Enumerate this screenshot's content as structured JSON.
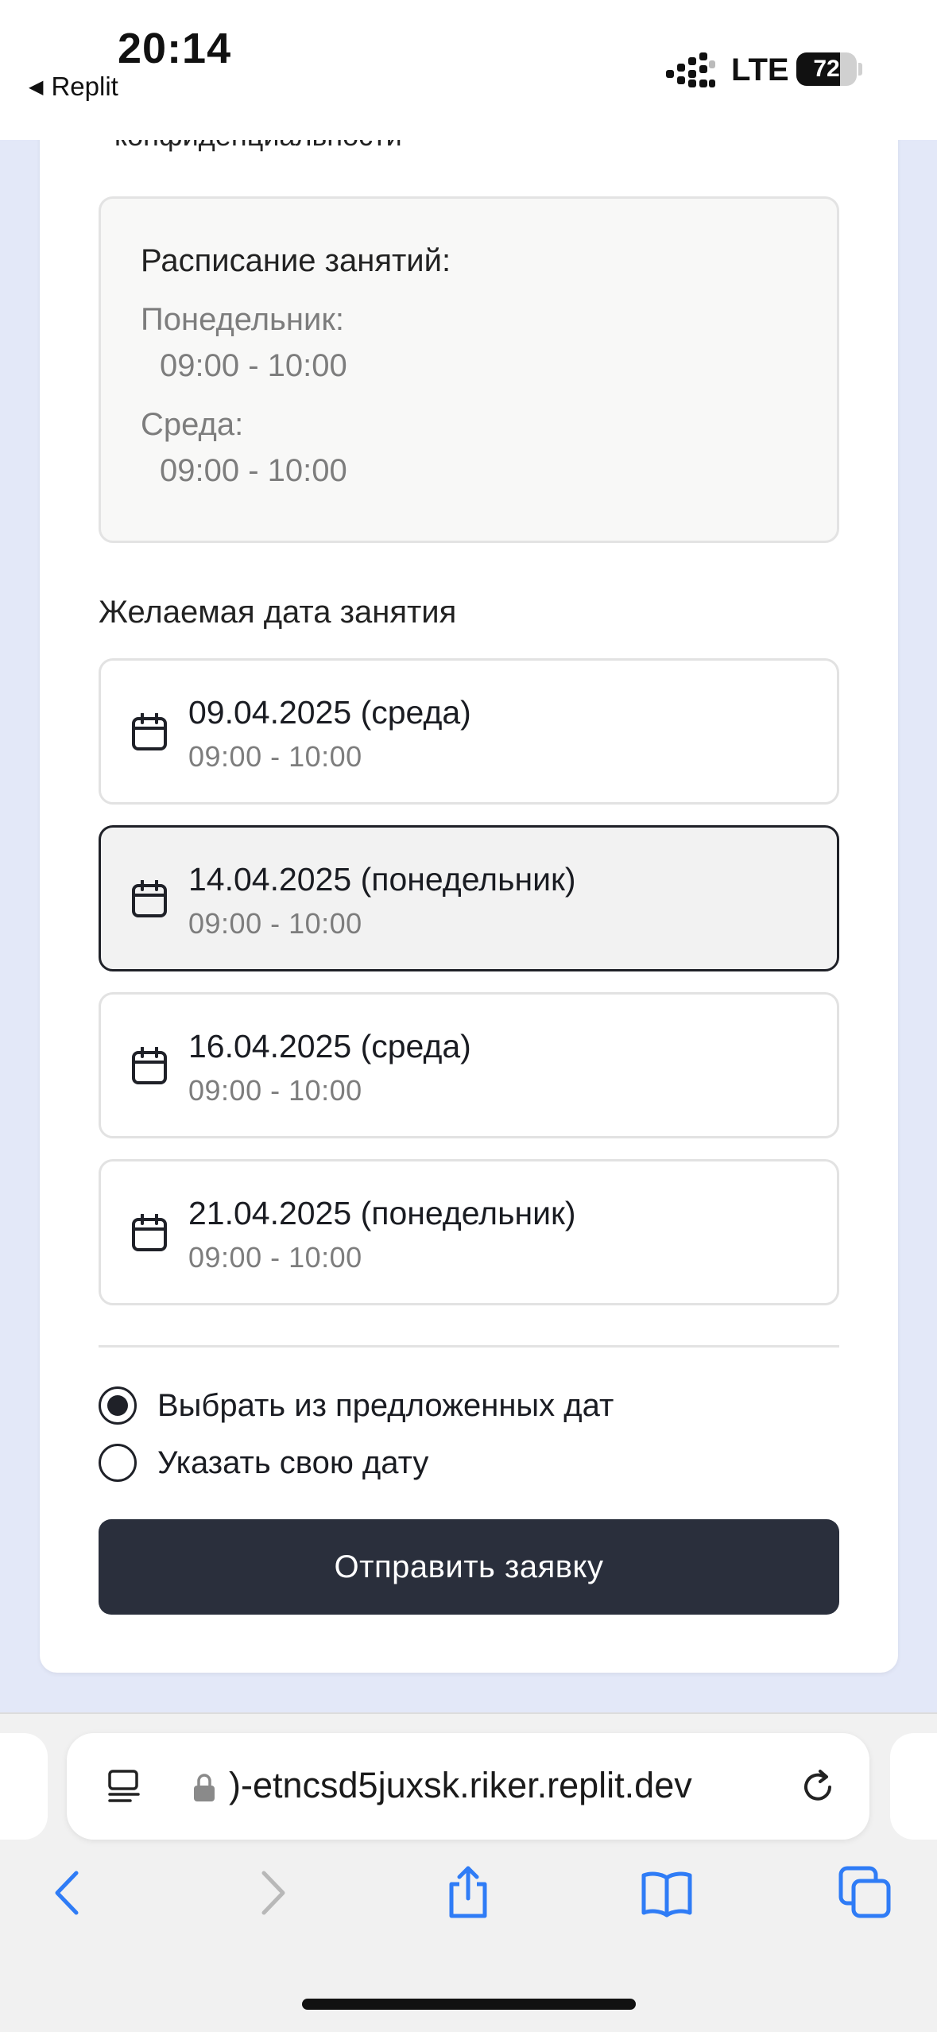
{
  "status_bar": {
    "time": "20:14",
    "back_app": "Replit",
    "network": "LTE",
    "battery_percent": 72
  },
  "page": {
    "clipped_text": "конфиденциальности",
    "schedule": {
      "title": "Расписание занятий:",
      "entries": [
        {
          "day": "Понедельник:",
          "time": "09:00 - 10:00"
        },
        {
          "day": "Среда:",
          "time": "09:00 - 10:00"
        }
      ]
    },
    "date_label": "Желаемая дата занятия",
    "date_options": [
      {
        "title": "09.04.2025 (среда)",
        "time": "09:00 - 10:00",
        "selected": false
      },
      {
        "title": "14.04.2025 (понедельник)",
        "time": "09:00 - 10:00",
        "selected": true
      },
      {
        "title": "16.04.2025 (среда)",
        "time": "09:00 - 10:00",
        "selected": false
      },
      {
        "title": "21.04.2025 (понедельник)",
        "time": "09:00 - 10:00",
        "selected": false
      }
    ],
    "radio_options": [
      {
        "label": "Выбрать из предложенных дат",
        "checked": true
      },
      {
        "label": "Указать свою дату",
        "checked": false
      }
    ],
    "submit_label": "Отправить заявку"
  },
  "browser": {
    "url": ")-etncsd5juxsk.riker.replit.dev",
    "icons": [
      "reader-mode-icon",
      "lock-icon",
      "reload-icon",
      "back-icon",
      "forward-icon",
      "share-icon",
      "bookmarks-icon",
      "tabs-icon"
    ]
  },
  "colors": {
    "page_background": "#e3e8f8",
    "button_dark": "#2a2f3c",
    "selected_border": "#1f2128",
    "muted_text": "#7d7d7d",
    "browser_accent": "#2f7cf6"
  }
}
